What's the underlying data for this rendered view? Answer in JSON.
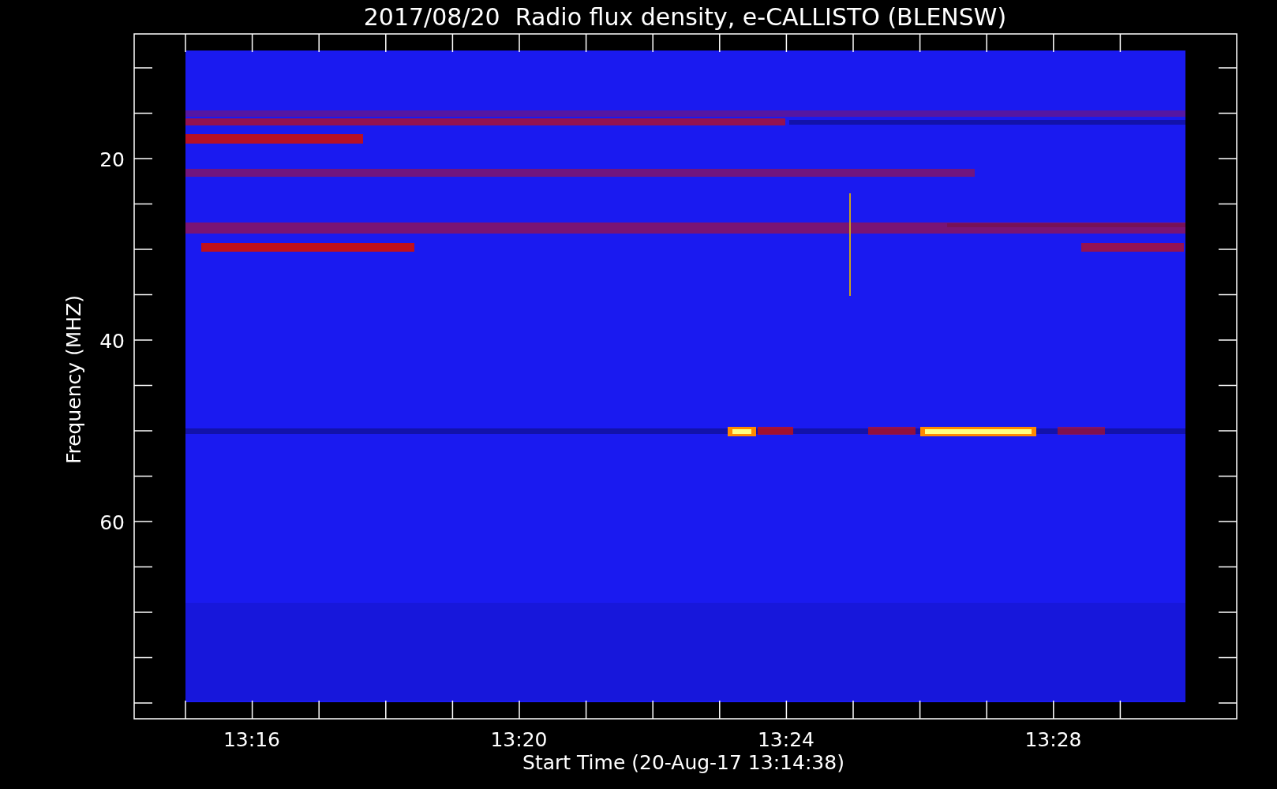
{
  "title": "2017/08/20  Radio flux density, e-CALLISTO (BLENSW)",
  "ylabel": "Frequency (MHZ)",
  "xlabel": "Start Time (20-Aug-17 13:14:38)",
  "yticks": [
    "20",
    "40",
    "60"
  ],
  "xticks": [
    "13:16",
    "13:20",
    "13:24",
    "13:28"
  ]
}
